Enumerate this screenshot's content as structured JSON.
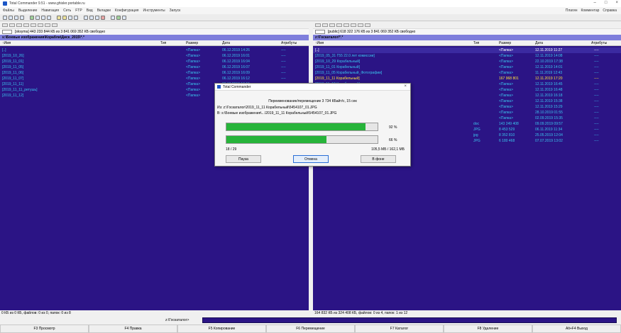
{
  "window": {
    "title": "Total Commander 9.51 - www.ghisler.portable.ru",
    "minimize_glyph": "–",
    "maximize_glyph": "□",
    "close_glyph": "×"
  },
  "menu": {
    "items": [
      "Файлы",
      "Выделение",
      "Навигация",
      "Сеть",
      "FTP",
      "Вид",
      "Вкладки",
      "Конфигурация",
      "Инструменты",
      "Запуск"
    ],
    "right_items": [
      "Плагин",
      "Комментар",
      "Справка"
    ]
  },
  "left_panel": {
    "drives_row": "c  d  e  f  z  \\  ..",
    "drive_selector": "c",
    "drive_info": "[sksyma] 443 233 844 КБ из 3 841 069 352 КБ свободно",
    "path": "s:\\Боевые изображения\\Корабли\\Диск_2015\\*.*",
    "columns": {
      "name": "↑Имя",
      "type": "Тип",
      "size": "Размер",
      "date": "Дата",
      "attr": "Атрибуты"
    },
    "rows": [
      {
        "name": "[..]",
        "type": "",
        "size": "<Папка>",
        "date": "06.12.2019 14:26",
        "attr": "----"
      },
      {
        "name": "[2019_10_26]",
        "type": "",
        "size": "<Папка>",
        "date": "06.12.2019 16:01",
        "attr": "----"
      },
      {
        "name": "[2019_11_01]",
        "type": "",
        "size": "<Папка>",
        "date": "06.12.2019 16:04",
        "attr": "----"
      },
      {
        "name": "[2019_11_05]",
        "type": "",
        "size": "<Папка>",
        "date": "06.12.2019 16:07",
        "attr": "----"
      },
      {
        "name": "[2019_11_06]",
        "type": "",
        "size": "<Папка>",
        "date": "06.12.2019 16:09",
        "attr": "----"
      },
      {
        "name": "[2019_11_07]",
        "type": "",
        "size": "<Папка>",
        "date": "06.12.2019 16:12",
        "attr": "----"
      },
      {
        "name": "[2019_11_11]",
        "type": "",
        "size": "<Папка>",
        "date": "06.12.2019 16:15",
        "attr": "----"
      },
      {
        "name": "[2019_11_11_ретушь]",
        "type": "",
        "size": "<Папка>",
        "date": "06.12.2019 16:17",
        "attr": "----"
      },
      {
        "name": "[2019_11_12]",
        "type": "",
        "size": "<Папка>",
        "date": "06.12.2019 16:20",
        "attr": "----"
      }
    ],
    "status": "0 КБ из 0 КБ, файлов: 0 из 0, папок: 0 из 8"
  },
  "right_panel": {
    "drive_selector": "z",
    "drive_info": "[public] 618 322 176 КБ из 3 841 069 352 КБ свободно",
    "path": "z:\\Госкаталог\\*.*",
    "columns": {
      "name": "↑Имя",
      "type": "Тип",
      "size": "Размер",
      "date": "Дата",
      "attr": "Атрибуты"
    },
    "rows": [
      {
        "name": "[..]",
        "type": "",
        "size": "<Папка>",
        "date": "12.11.2019 11:27",
        "attr": "----",
        "cls": "parent"
      },
      {
        "name": "[2019_05_31 Г55 22.0 лет комиссии]",
        "type": "",
        "size": "<Папка>",
        "date": "12.11.2019 14:08",
        "attr": "----",
        "cls": ""
      },
      {
        "name": "[2019_10_29 Корабельный]",
        "type": "",
        "size": "<Папка>",
        "date": "22.10.2019 17:38",
        "attr": "----",
        "cls": ""
      },
      {
        "name": "[2019_11_01 Корабельный]",
        "type": "",
        "size": "<Папка>",
        "date": "12.11.2019 14:01",
        "attr": "----",
        "cls": ""
      },
      {
        "name": "[2019_11_05 Корабельный_Фотографии]",
        "type": "",
        "size": "<Папка>",
        "date": "11.11.2019 12:43",
        "attr": "----",
        "cls": ""
      },
      {
        "name": "[2019_11_11 Корабельный]",
        "type": "",
        "size": "167 968 801",
        "date": "12.11.2019 17:20",
        "attr": "----",
        "cls": "sel"
      },
      {
        "name": "[2019_11_12 Корабельный]",
        "type": "",
        "size": "<Папка>",
        "date": "12.11.2019 16:45",
        "attr": "----",
        "cls": ""
      },
      {
        "name": "[Архив]",
        "type": "",
        "size": "<Папка>",
        "date": "12.11.2019 16:48",
        "attr": "----",
        "cls": ""
      },
      {
        "name": "[Документы]",
        "type": "",
        "size": "<Папка>",
        "date": "12.11.2019 16:18",
        "attr": "----",
        "cls": ""
      },
      {
        "name": "[Отчеты]",
        "type": "",
        "size": "<Папка>",
        "date": "12.11.2019 15:38",
        "attr": "----",
        "cls": ""
      },
      {
        "name": "[Презентации]",
        "type": "",
        "size": "<Папка>",
        "date": "12.11.2019 15:29",
        "attr": "----",
        "cls": ""
      },
      {
        "name": "[Фото]",
        "type": "",
        "size": "<Папка>",
        "date": "28.10.2019 01:55",
        "attr": "----",
        "cls": ""
      },
      {
        "name": "[Шаблоны]",
        "type": "",
        "size": "<Папка>",
        "date": "02.09.2019 15:35",
        "attr": "----",
        "cls": ""
      },
      {
        "name": "Госкаталог",
        "type": "doc",
        "size": "143 249 408",
        "date": "09.09.2019 09:57",
        "attr": "----",
        "cls": ""
      },
      {
        "name": "Госкаталог_обложка",
        "type": "JPG",
        "size": "8 453 529",
        "date": "06.11.2019 11:34",
        "attr": "----",
        "cls": ""
      },
      {
        "name": "План графия внесения в Госкаталог",
        "type": "jpg",
        "size": "8 352 810",
        "date": "25.05.2019 12:04",
        "attr": "----",
        "cls": ""
      },
      {
        "name": "Порядок внесения в Госкаталог",
        "type": "JPG",
        "size": "6 180 468",
        "date": "07.07.2019 13:02",
        "attr": "----",
        "cls": ""
      }
    ],
    "status": "164 832 КБ из 324 408 КБ, файлов: 0 из 4, папок: 1 из 12"
  },
  "command_line": {
    "prompt": "z:\\Госкаталог>"
  },
  "fkeys": [
    "F3 Просмотр",
    "F4 Правка",
    "F5 Копирование",
    "F6 Перемещение",
    "F7 Каталог",
    "F8 Удаление",
    "Alt+F4 Выход"
  ],
  "dialog": {
    "title": "Total Commander",
    "close_glyph": "×",
    "message": "Переименование/перемещение 3 734 КБайт/с, 15 сек",
    "from": "Из: z:\\Госкаталог\\2019_11_11 Корабельный\\5454107_01.JPG",
    "to": "В: s:\\Боевые изображения\\...\\2019_11_11 Корабельный\\5454107_01.JPG",
    "progress_file": 0.92,
    "progress_file_label": "92 %",
    "progress_total": 0.66,
    "progress_total_label": "66 %",
    "count": "18 / 29",
    "sizes": "105,5 МБ / 162,1 МБ",
    "buttons": {
      "pause": "Пауза",
      "cancel": "Отмена",
      "background": "В фоне"
    }
  },
  "colors": {
    "panel_bg": "#2b1485",
    "file_text": "#3ac6ee",
    "selected_text": "#ffe33a",
    "progress_fill": "#27b43a"
  }
}
